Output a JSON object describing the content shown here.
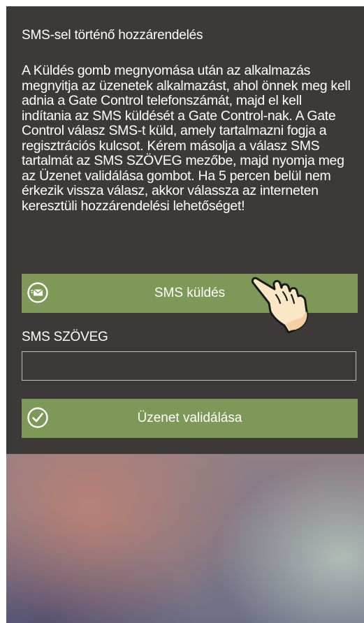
{
  "heading": "SMS-sel történő hozzárendelés",
  "instructions": "A Küldés gomb megnyomása után az alkalmazás megnyitja az üzenetek alkalmazást, ahol önnek meg kell adnia a Gate Control telefonszámát, majd el kell indítania az SMS küldését a Gate Control-nak. A Gate Control válasz SMS-t küld, amely tartalmazni fogja a regisztrációs kulcsot. Kérem másolja a válasz SMS tartalmát az SMS SZÖVEG mezőbe, majd nyomja meg az Üzenet validálása gombot. Ha 5 percen belül nem érkezik vissza válasz, akkor válassza az interneten keresztüli hozzárendelési lehetőséget!",
  "send_button": {
    "label": "SMS küldés",
    "icon": "sms-envelope-icon"
  },
  "sms_field": {
    "label": "SMS SZÖVEG",
    "value": "",
    "placeholder": ""
  },
  "validate_button": {
    "label": "Üzenet validálása",
    "icon": "checkmark-circle-icon"
  },
  "tap_hint_icon": "pointing-hand-icon",
  "colors": {
    "panel": "#3d3939",
    "button": "#7e9857",
    "text": "#ffffff",
    "input_border": "#bdbdbd"
  }
}
